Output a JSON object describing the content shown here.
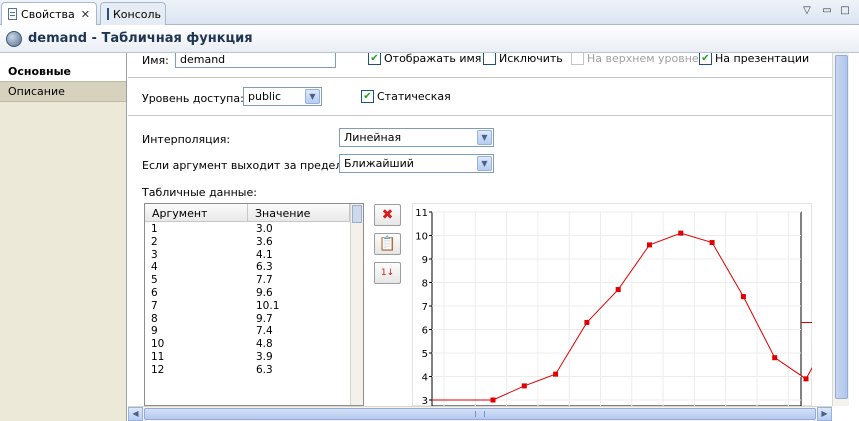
{
  "tabs": [
    {
      "label": "Свойства",
      "icon": "properties-icon"
    },
    {
      "label": "Консоль",
      "icon": "console-icon"
    }
  ],
  "header": {
    "title": "demand - Табличная функция"
  },
  "nav": {
    "items": [
      "Основные",
      "Описание"
    ]
  },
  "form": {
    "name_label": "Имя:",
    "name_value": "demand",
    "show_name": {
      "label": "Отображать имя",
      "checked": true
    },
    "exclude": {
      "label": "Исключить",
      "checked": false
    },
    "top_level": {
      "label": "На верхнем уровне",
      "checked": false,
      "enabled": false
    },
    "on_presentation": {
      "label": "На презентации",
      "checked": true
    },
    "access_label": "Уровень доступа:",
    "access_value": "public",
    "static": {
      "label": "Статическая",
      "checked": true
    },
    "interp_label": "Интерполяция:",
    "interp_value": "Линейная",
    "outside_label": "Если аргумент выходит за пределы:",
    "outside_value": "Ближайший",
    "table_label": "Табличные данные:"
  },
  "table": {
    "columns": [
      "Аргумент",
      "Значение"
    ],
    "rows": [
      [
        "1",
        "3.0"
      ],
      [
        "2",
        "3.6"
      ],
      [
        "3",
        "4.1"
      ],
      [
        "4",
        "6.3"
      ],
      [
        "5",
        "7.7"
      ],
      [
        "6",
        "9.6"
      ],
      [
        "7",
        "10.1"
      ],
      [
        "8",
        "9.7"
      ],
      [
        "9",
        "7.4"
      ],
      [
        "10",
        "4.8"
      ],
      [
        "11",
        "3.9"
      ],
      [
        "12",
        "6.3"
      ]
    ]
  },
  "chart_data": {
    "type": "line",
    "x": [
      1,
      2,
      3,
      4,
      5,
      6,
      7,
      8,
      9,
      10,
      11,
      12
    ],
    "values": [
      3.0,
      3.6,
      4.1,
      6.3,
      7.7,
      9.6,
      10.1,
      9.7,
      7.4,
      4.8,
      3.9,
      6.3
    ],
    "y_ticks": [
      3,
      4,
      5,
      6,
      7,
      8,
      9,
      10,
      11
    ],
    "ylim": [
      3,
      11
    ],
    "grid": true,
    "color": "#e00000",
    "extrapolation": "nearest"
  }
}
